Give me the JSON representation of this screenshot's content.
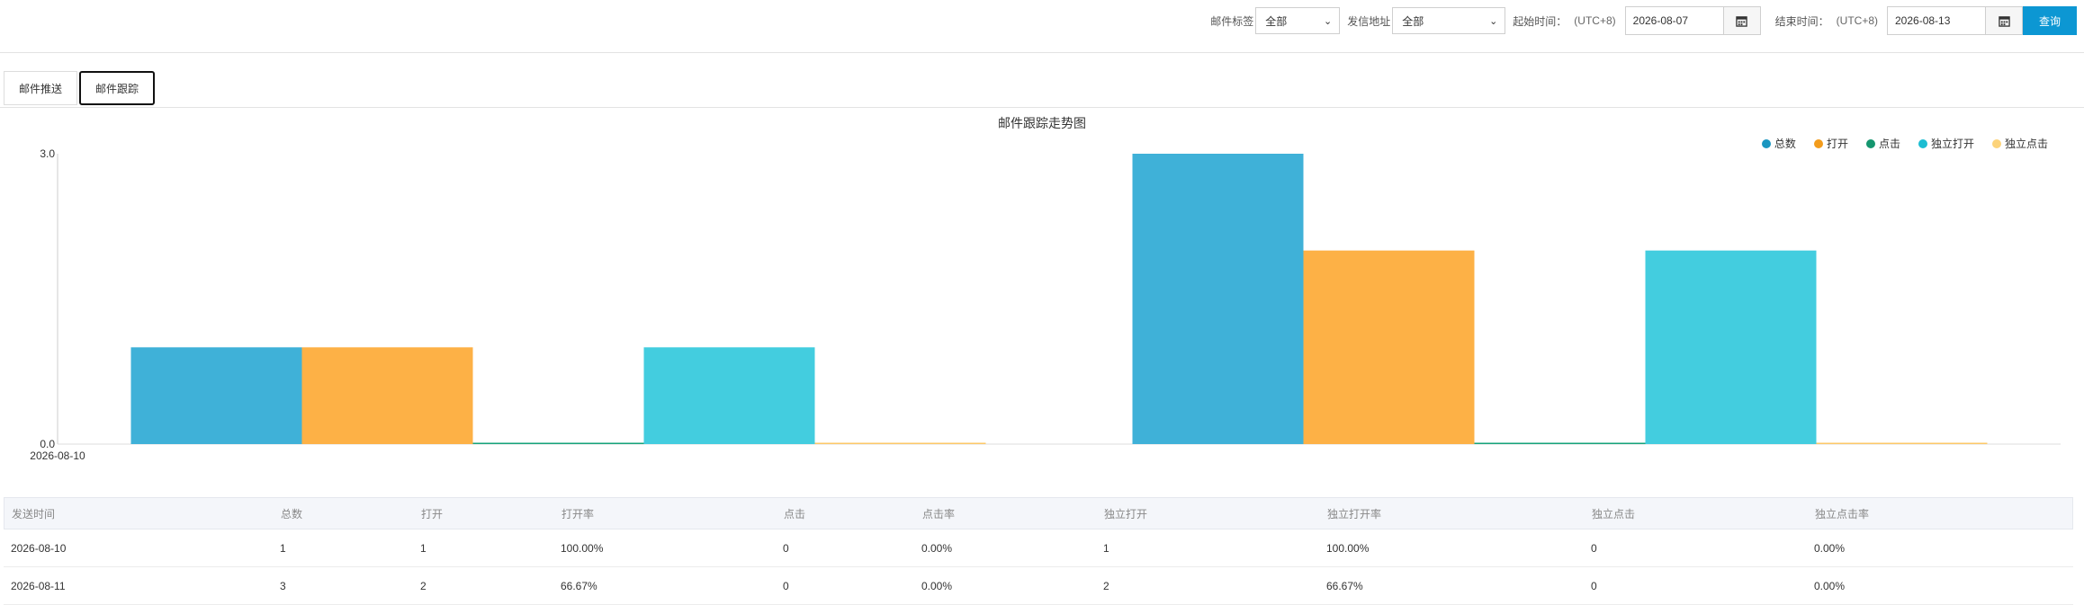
{
  "filters": {
    "tag_label": "邮件标签",
    "tag_value": "全部",
    "sender_label": "发信地址",
    "sender_value": "全部",
    "start_label": "起始时间：",
    "start_tz": "(UTC+8)",
    "start_date": "2026-08-07",
    "end_label": "结束时间：",
    "end_tz": "(UTC+8)",
    "end_date": "2026-08-13",
    "query_button": "查询"
  },
  "tabs": [
    {
      "label": "邮件推送",
      "active": false
    },
    {
      "label": "邮件跟踪",
      "active": true
    }
  ],
  "chart_data": {
    "type": "bar",
    "title": "邮件跟踪走势图",
    "categories": [
      "2026-08-10",
      "2026-08-11"
    ],
    "x_tick_labels": [
      "2026-08-10"
    ],
    "y_ticks": [
      "3.0",
      "0.0"
    ],
    "ylim": [
      0,
      3
    ],
    "legend_position": "top-right",
    "series": [
      {
        "name": "总数",
        "values": [
          1,
          3
        ],
        "color": "#3fb1d8",
        "legend_color": "#1a96c0"
      },
      {
        "name": "打开",
        "values": [
          1,
          2
        ],
        "color": "#fdb146",
        "legend_color": "#f39c1c"
      },
      {
        "name": "点击",
        "values": [
          0,
          0
        ],
        "color": "#15a37a",
        "legend_color": "#15966f"
      },
      {
        "name": "独立打开",
        "values": [
          1,
          2
        ],
        "color": "#43cddf",
        "legend_color": "#1cbdd2"
      },
      {
        "name": "独立点击",
        "values": [
          0,
          0
        ],
        "color": "#fdc868",
        "legend_color": "#fcd37a"
      }
    ]
  },
  "table": {
    "columns": [
      "发送时间",
      "总数",
      "打开",
      "打开率",
      "点击",
      "点击率",
      "独立打开",
      "独立打开率",
      "独立点击",
      "独立点击率"
    ],
    "rows": [
      [
        "2026-08-10",
        "1",
        "1",
        "100.00%",
        "0",
        "0.00%",
        "1",
        "100.00%",
        "0",
        "0.00%"
      ],
      [
        "2026-08-11",
        "3",
        "2",
        "66.67%",
        "0",
        "0.00%",
        "2",
        "66.67%",
        "0",
        "0.00%"
      ]
    ]
  }
}
